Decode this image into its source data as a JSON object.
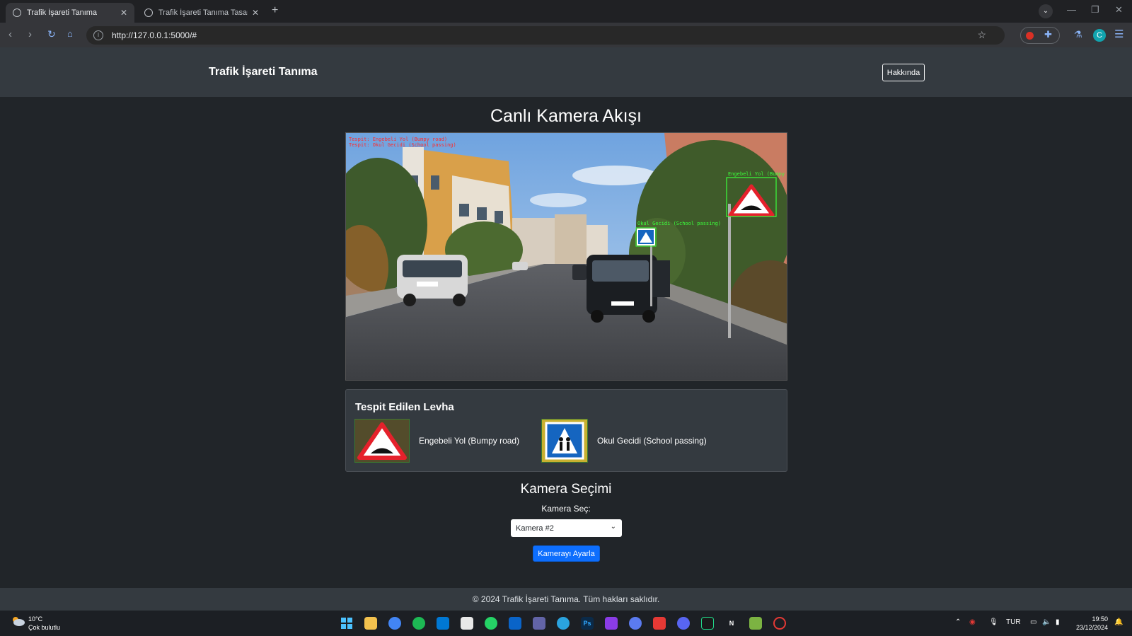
{
  "browser": {
    "tabs": [
      {
        "title": "Trafik İşareti Tanıma",
        "active": true
      },
      {
        "title": "Trafik İşareti Tanıma Tasarımı",
        "active": false
      }
    ],
    "new_tab": "+",
    "close_glyph": "✕",
    "url": "http://127.0.0.1:5000/#",
    "avatar_letter": "C"
  },
  "app": {
    "brand": "Trafik İşareti Tanıma",
    "about_button": "Hakkında",
    "stream_title": "Canlı Kamera Akışı",
    "camera_overlay": {
      "top_left_lines": [
        "Tespit: Engebeli Yol (Bumpy road)",
        "Tespit: Okul Gecidi (School passing)"
      ],
      "box_labels": [
        "Engebeli Yol (Bumpy road)",
        "Okul Gecidi (School passing)"
      ]
    },
    "detected_panel": {
      "title": "Tespit Edilen Levha",
      "signs": [
        {
          "name": "Engebeli Yol (Bumpy road)",
          "icon": "bumpy-road-sign-icon"
        },
        {
          "name": "Okul Gecidi (School passing)",
          "icon": "school-crossing-sign-icon"
        }
      ]
    },
    "camera_selection": {
      "title": "Kamera Seçimi",
      "label": "Kamera Seç:",
      "selected": "Kamera #2",
      "apply_button": "Kamerayı Ayarla"
    },
    "footer": "© 2024 Trafik İşareti Tanıma. Tüm hakları saklıdır."
  },
  "taskbar": {
    "weather_temp": "10°C",
    "weather_desc": "Çok bulutlu",
    "language": "TUR",
    "time": "19:50",
    "date": "23/12/2024"
  },
  "colors": {
    "page_bg": "#212529",
    "navbar_bg": "#343a40",
    "primary_button": "#0d6efd",
    "sign_red": "#e5212b",
    "sign_blue": "#1565c0",
    "detection_green": "#3bff3b",
    "detection_red": "#ff2a2a"
  }
}
